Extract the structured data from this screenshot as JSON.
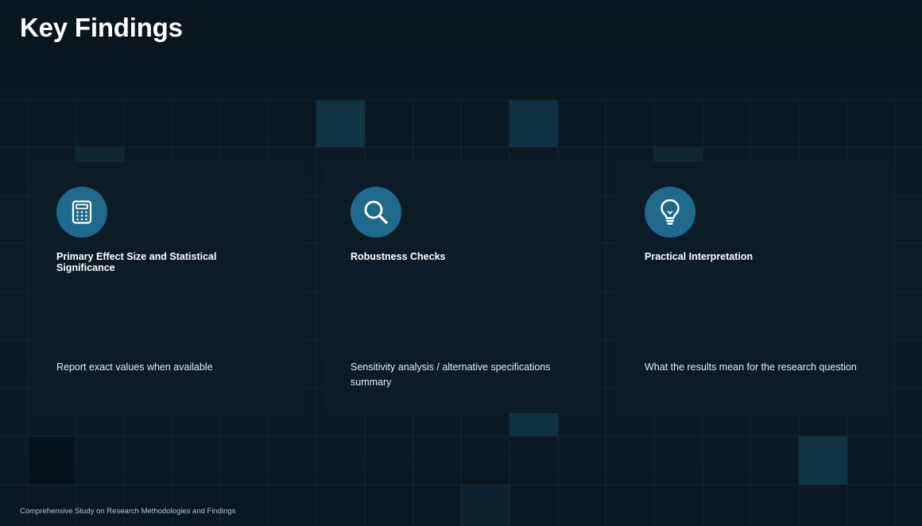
{
  "slide": {
    "title": "Key Findings",
    "footer": "Comprehensive Study on Research Methodologies and Findings"
  },
  "cards": [
    {
      "icon": "calculator-icon",
      "title": "Primary Effect Size and Statistical Significance",
      "body": "Report exact values when available"
    },
    {
      "icon": "magnifying-glass-icon",
      "title": "Robustness Checks",
      "body": "Sensitivity analysis / alternative specifications summary"
    },
    {
      "icon": "lightbulb-icon",
      "title": "Practical Interpretation",
      "body": "What the results mean for the research question"
    }
  ],
  "colors": {
    "background": "#0a1720",
    "card": "#0c1c27",
    "icon_circle": "#1f6a8c",
    "grid_line": "#16303d",
    "grid_highlight": "#12384b"
  }
}
